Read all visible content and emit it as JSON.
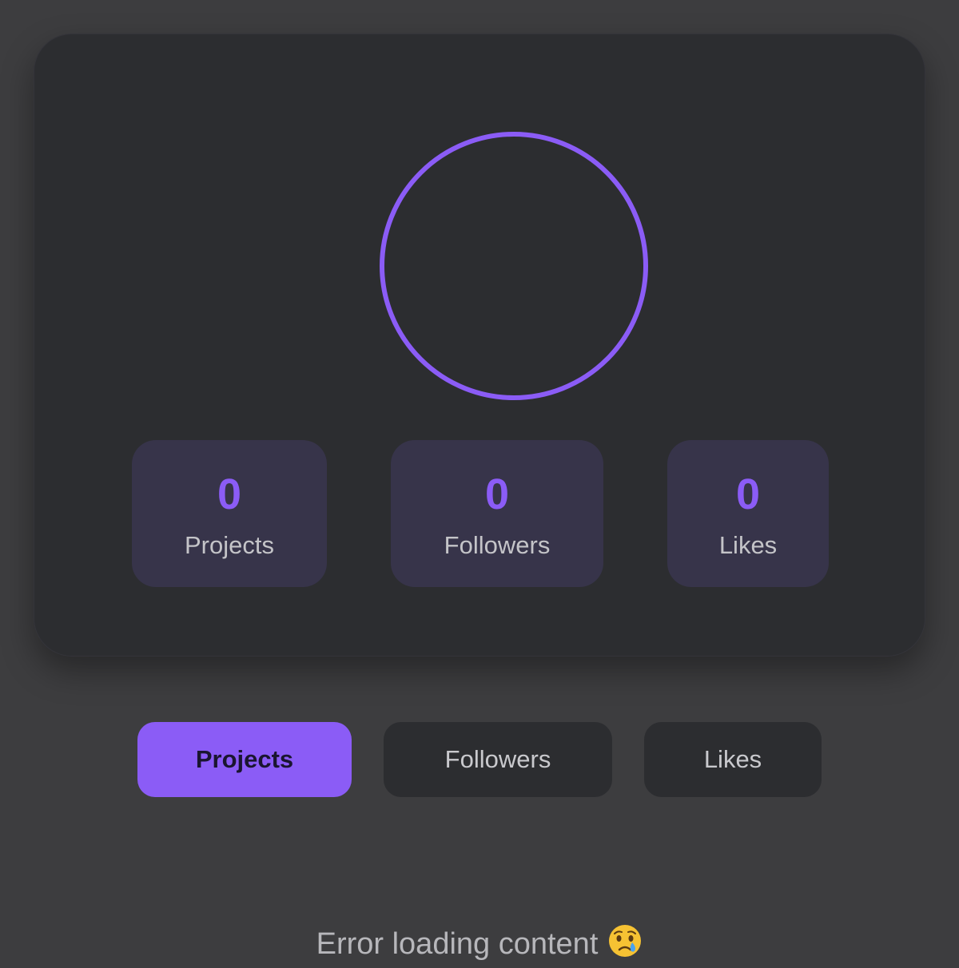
{
  "profile": {
    "avatar_ring_color": "#8b5cf6"
  },
  "stats": [
    {
      "value": "0",
      "label": "Projects"
    },
    {
      "value": "0",
      "label": "Followers"
    },
    {
      "value": "0",
      "label": "Likes"
    }
  ],
  "tabs": [
    {
      "label": "Projects",
      "active": true
    },
    {
      "label": "Followers",
      "active": false
    },
    {
      "label": "Likes",
      "active": false
    }
  ],
  "error": {
    "message": "Error loading content",
    "icon": "crying-face-icon"
  },
  "colors": {
    "accent": "#8b5cf6",
    "background": "#3d3d3f",
    "card": "#2c2d30",
    "stat_tile": "#37344a"
  }
}
